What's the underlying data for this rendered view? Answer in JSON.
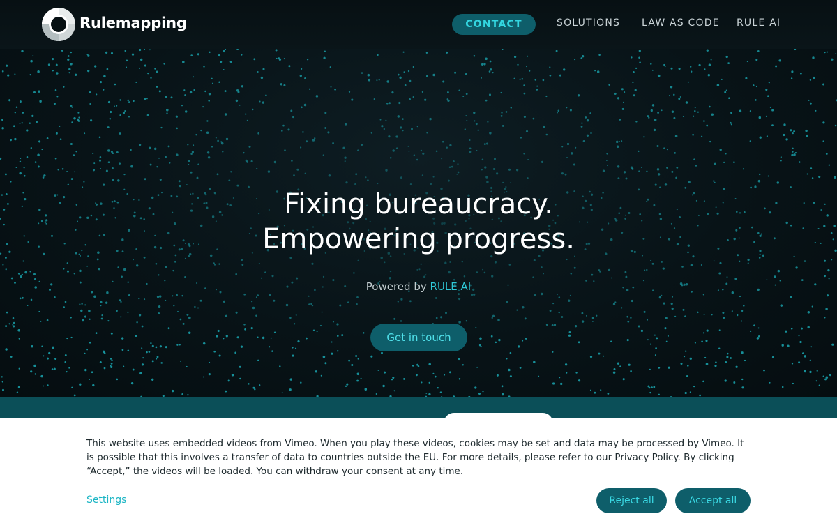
{
  "brand": {
    "name": "Rulemapping"
  },
  "nav": {
    "contact_label": "CONTACT",
    "items": [
      {
        "label": "SOLUTIONS"
      },
      {
        "label": "LAW AS CODE"
      },
      {
        "label": "RULE AI"
      }
    ]
  },
  "hero": {
    "headline_line1": "Fixing bureaucracy.",
    "headline_line2": "Empowering progress.",
    "powered_prefix": "Powered by",
    "powered_link": "RULE AI",
    "cta_label": "Get in touch"
  },
  "cookie_banner": {
    "text": "This website uses embedded videos from Vimeo. When you play these videos, cookies may be set and data may be processed by Vimeo. It is possible that this involves a transfer of data to countries outside the EU. For more details, please refer to our Privacy Policy. By clicking “Accept,” the videos will be loaded. You can withdraw your consent at any time.",
    "settings_label": "Settings",
    "reject_label": "Reject all",
    "accept_label": "Accept all"
  },
  "colors": {
    "accent": "#0e5e6a",
    "accent_text": "#33d6e0",
    "background": "#0a1419"
  }
}
